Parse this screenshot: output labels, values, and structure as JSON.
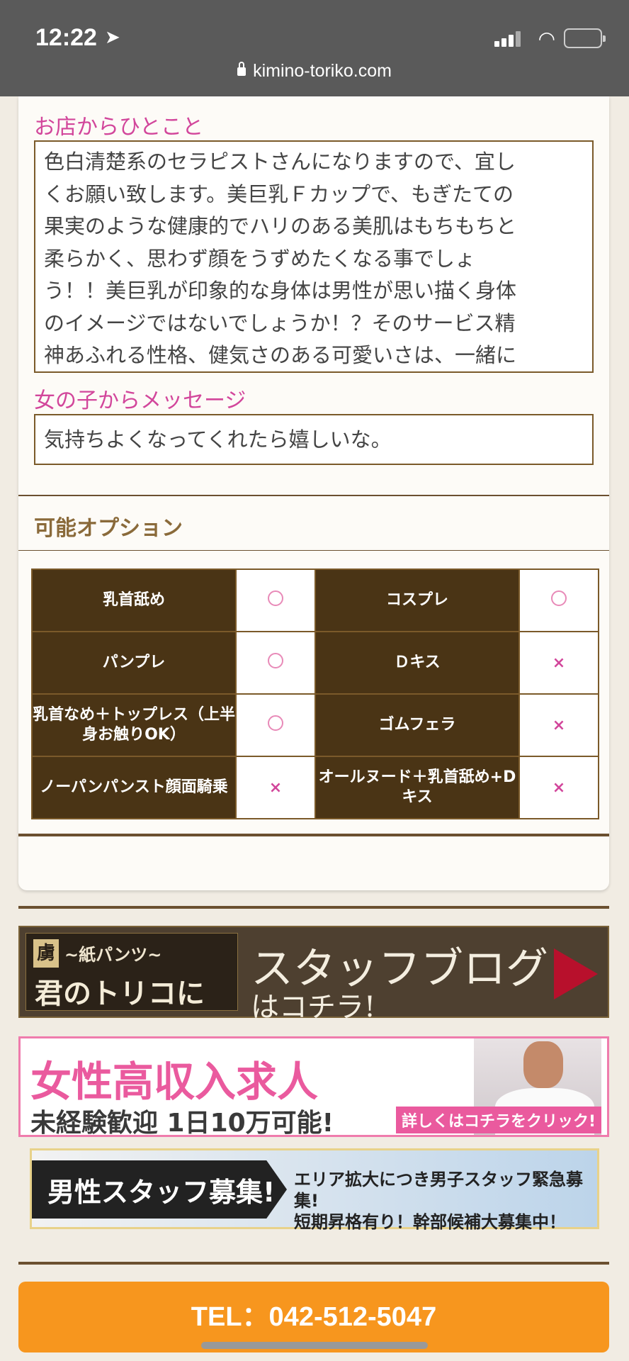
{
  "status_bar": {
    "time": "12:22",
    "url": "kimino-toriko.com"
  },
  "shop_comment": {
    "title": "お店からひとこと",
    "lines": [
      "色白清楚系のセラピストさんになりますので、宜し",
      "くお願い致します。美巨乳Ｆカップで、もぎたての",
      "果実のような健康的でハリのある美肌はもちもちと",
      "柔らかく、思わず顔をうずめたくなる事でしょ",
      "う！！美巨乳が印象的な身体は男性が思い描く身体",
      "のイメージではないでしょうか！？そのサービス精",
      "神あふれる性格、健気さのある可愛いさは、一緒に"
    ]
  },
  "girl_message": {
    "title": "女の子からメッセージ",
    "text": "気持ちよくなってくれたら嬉しいな。"
  },
  "options": {
    "title": "可能オプション",
    "rows": [
      [
        {
          "name": "乳首舐め",
          "mark": "o"
        },
        {
          "name": "コスプレ",
          "mark": "o"
        }
      ],
      [
        {
          "name": "パンプレ",
          "mark": "o"
        },
        {
          "name": "Ｄキス",
          "mark": "x"
        }
      ],
      [
        {
          "name": "乳首なめ＋トップレス（上半身お触りOK）",
          "mark": "o"
        },
        {
          "name": "ゴムフェラ",
          "mark": "x"
        }
      ],
      [
        {
          "name": "ノーパンパンスト顔面騎乗",
          "mark": "x"
        },
        {
          "name": "オールヌード＋乳首舐め+Dキス",
          "mark": "x"
        }
      ]
    ]
  },
  "banners": {
    "blog": {
      "logo_badge": "虜",
      "logo_line1": "~紙パンツ~",
      "logo_line2": "君のトリコに",
      "title": "スタッフブログ",
      "subtitle": "はコチラ!"
    },
    "women_jobs": {
      "title": "女性高収入求人",
      "subtitle": "未経験歓迎 1日10万可能!",
      "cta": "詳しくはコチラをクリック!"
    },
    "men_jobs": {
      "title": "男性スタッフ募集!",
      "line1": "エリア拡大につき男子スタッフ緊急募集!",
      "line2": "短期昇格有り！幹部候補大募集中！"
    }
  },
  "tel_button": {
    "label": "TEL：042-512-5047"
  },
  "colors": {
    "accent_pink": "#d2469b",
    "brown": "#4a3415",
    "tel_orange": "#f7961e"
  }
}
